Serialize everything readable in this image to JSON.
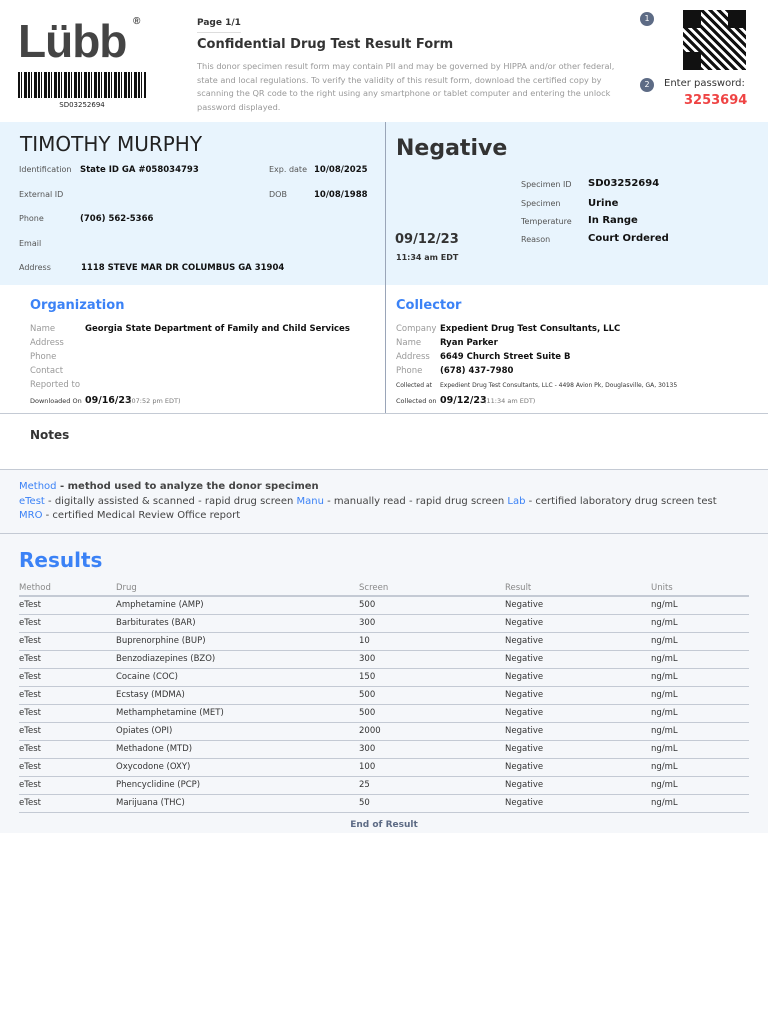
{
  "header": {
    "logo": "Lübb",
    "barcode_number": "SD03252694",
    "page": "Page 1/1",
    "title": "Confidential Drug Test Result Form",
    "disclaimer": "This donor specimen result form may contain PII and may be governed by HIPPA and/or other federal, state and local regulations. To verify the validity of this result form, download the certified copy by scanning the QR code to the right using any smartphone or tablet computer and entering the unlock password displayed.",
    "step1": "1",
    "step2": "2",
    "password_label": "Enter password:",
    "password": "3253694"
  },
  "donor": {
    "name": "TIMOTHY MURPHY",
    "identification_label": "Identification",
    "identification": "State ID GA #058034793",
    "exp_label": "Exp. date",
    "exp": "10/08/2025",
    "external_label": "External ID",
    "dob_label": "DOB",
    "dob": "10/08/1988",
    "phone_label": "Phone",
    "phone": "(706) 562-5366",
    "email_label": "Email",
    "address_label": "Address",
    "address": "1118 STEVE MAR DR COLUMBUS GA 31904"
  },
  "result": {
    "status": "Negative",
    "date": "09/12/23",
    "time": "11:34 am EDT",
    "specimen_id_label": "Specimen ID",
    "specimen_id": "SD03252694",
    "specimen_label": "Specimen",
    "specimen": "Urine",
    "temperature_label": "Temperature",
    "temperature": "In Range",
    "reason_label": "Reason",
    "reason": "Court Ordered"
  },
  "organization": {
    "heading": "Organization",
    "name_label": "Name",
    "name": "Georgia State Department of Family and Child Services",
    "address_label": "Address",
    "phone_label": "Phone",
    "contact_label": "Contact",
    "reported_label": "Reported to",
    "downloaded_label": "Downloaded On",
    "downloaded_date": "09/16/23",
    "downloaded_time": "(07:52 pm EDT)"
  },
  "collector": {
    "heading": "Collector",
    "company_label": "Company",
    "company": "Expedient Drug Test Consultants, LLC",
    "name_label": "Name",
    "name": "Ryan Parker",
    "address_label": "Address",
    "address": "6649 Church Street Suite B",
    "phone_label": "Phone",
    "phone": "(678) 437-7980",
    "collected_at_label": "Collected at",
    "collected_at": "Expedient Drug Test Consultants, LLC - 4498 Avion Pk, Douglasville, GA, 30135",
    "collected_on_label": "Collected on",
    "collected_on_date": "09/12/23",
    "collected_on_time": "(11:34 am EDT)"
  },
  "notes": {
    "heading": "Notes",
    "method": "Method",
    "method_desc": " - method used to analyze the donor specimen",
    "etest": "eTest",
    "etest_desc": " - digitally assisted & scanned - rapid drug screen ",
    "manu": "Manu",
    "manu_desc": " - manually read - rapid drug screen ",
    "lab": "Lab",
    "lab_desc": " - certified laboratory drug screen test",
    "mro": "MRO",
    "mro_desc": " - certified Medical Review Office report"
  },
  "results": {
    "heading": "Results",
    "columns": [
      "Method",
      "Drug",
      "Screen",
      "Result",
      "Units"
    ],
    "rows": [
      [
        "eTest",
        "Amphetamine (AMP)",
        "500",
        "Negative",
        "ng/mL"
      ],
      [
        "eTest",
        "Barbiturates (BAR)",
        "300",
        "Negative",
        "ng/mL"
      ],
      [
        "eTest",
        "Buprenorphine (BUP)",
        "10",
        "Negative",
        "ng/mL"
      ],
      [
        "eTest",
        "Benzodiazepines (BZO)",
        "300",
        "Negative",
        "ng/mL"
      ],
      [
        "eTest",
        "Cocaine (COC)",
        "150",
        "Negative",
        "ng/mL"
      ],
      [
        "eTest",
        "Ecstasy (MDMA)",
        "500",
        "Negative",
        "ng/mL"
      ],
      [
        "eTest",
        "Methamphetamine (MET)",
        "500",
        "Negative",
        "ng/mL"
      ],
      [
        "eTest",
        "Opiates (OPI)",
        "2000",
        "Negative",
        "ng/mL"
      ],
      [
        "eTest",
        "Methadone (MTD)",
        "300",
        "Negative",
        "ng/mL"
      ],
      [
        "eTest",
        "Oxycodone (OXY)",
        "100",
        "Negative",
        "ng/mL"
      ],
      [
        "eTest",
        "Phencyclidine (PCP)",
        "25",
        "Negative",
        "ng/mL"
      ],
      [
        "eTest",
        "Marijuana (THC)",
        "50",
        "Negative",
        "ng/mL"
      ]
    ],
    "end": "End of Result"
  }
}
